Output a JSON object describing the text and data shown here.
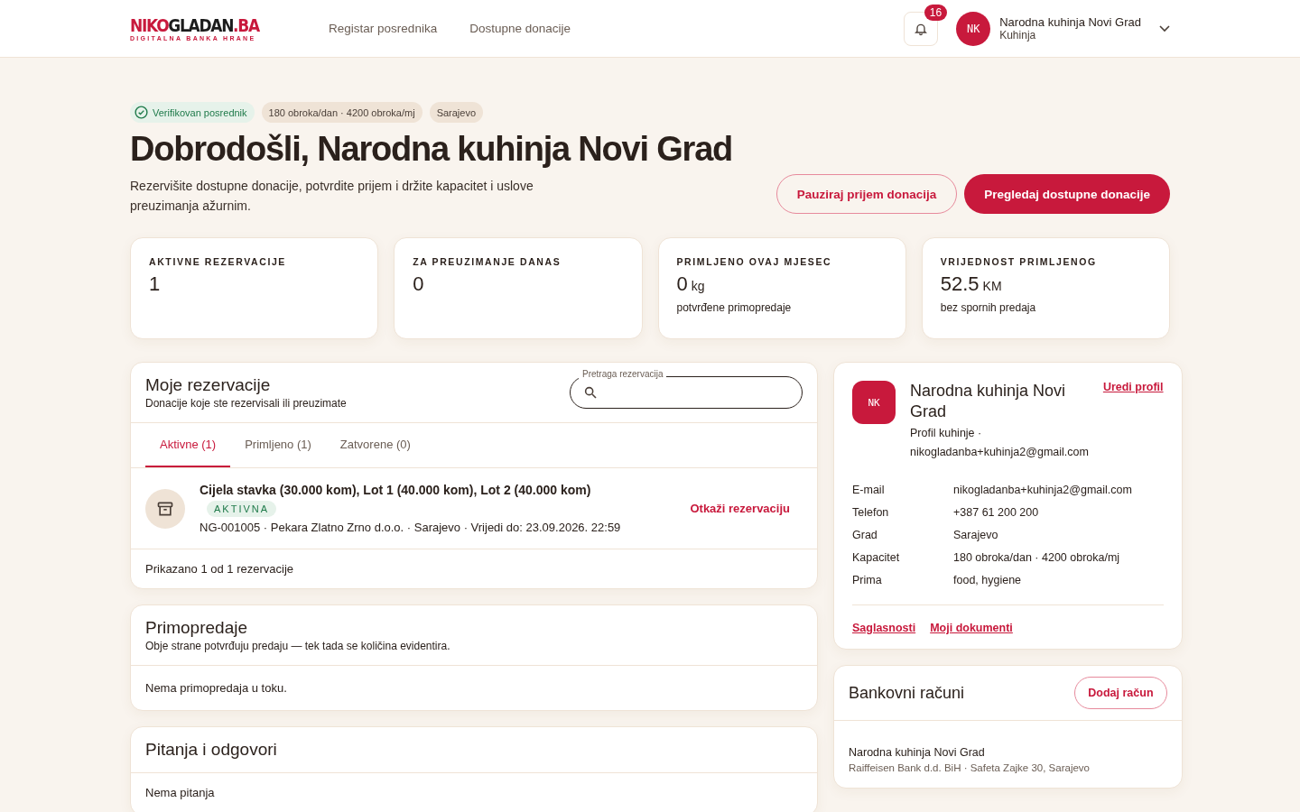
{
  "header": {
    "logo": {
      "accent_start": "NIKO",
      "main": "GLADAN",
      "accent_end": ".BA",
      "tagline": "DIGITALNA BANKA HRANE"
    },
    "nav": [
      "Registar posrednika",
      "Dostupne donacije"
    ],
    "notifications": {
      "count": "16"
    },
    "user": {
      "initials": "NK",
      "name": "Narodna kuhinja Novi Grad",
      "role": "Kuhinja"
    }
  },
  "hero": {
    "badges": [
      {
        "kind": "verified",
        "label": "Verifikovan posrednik"
      },
      {
        "kind": "plain",
        "label": "180 obroka/dan · 4200 obroka/mj"
      },
      {
        "kind": "plain",
        "label": "Sarajevo"
      }
    ],
    "title": "Dobrodošli, Narodna kuhinja Novi Grad",
    "subtitle": "Rezervišite dostupne donacije, potvrdite prijem i držite kapacitet i uslove preuzimanja ažurnim.",
    "buttons": [
      {
        "kind": "outline",
        "label": "Pauziraj prijem donacija"
      },
      {
        "kind": "primary",
        "label": "Pregledaj dostupne donacije"
      }
    ]
  },
  "stats": [
    {
      "label": "AKTIVNE REZERVACIJE",
      "value": "1"
    },
    {
      "label": "ZA PREUZIMANJE DANAS",
      "value": "0"
    },
    {
      "label": "PRIMLJENO OVAJ MJESEC",
      "value": "0",
      "unit": "kg",
      "note": "potvrđene primopredaje"
    },
    {
      "label": "VRIJEDNOST PRIMLJENOG",
      "value": "52.5",
      "unit": "KM",
      "note": "bez spornih predaja"
    }
  ],
  "reservations": {
    "title": "Moje rezervacije",
    "subtitle": "Donacije koje ste rezervisali ili preuzimate",
    "search": {
      "label": "Pretraga rezervacija"
    },
    "tabs": [
      {
        "label": "Aktivne (1)",
        "selected": true
      },
      {
        "label": "Primljeno (1)",
        "selected": false
      },
      {
        "label": "Zatvorene (0)",
        "selected": false
      }
    ],
    "items": [
      {
        "title": "Cijela stavka (30.000 kom), Lot 1 (40.000 kom), Lot 2 (40.000 kom)",
        "status": "AKTIVNA",
        "meta": "NG-001005 · Pekara Zlatno Zrno d.o.o. · Sarajevo · Vrijedi do: 23.09.2026. 22:59",
        "action": "Otkaži rezervaciju"
      }
    ],
    "footer": "Prikazano 1 od 1 rezervacije"
  },
  "handovers": {
    "title": "Primopredaje",
    "subtitle": "Obje strane potvrđuju predaju — tek tada se količina evidentira.",
    "empty": "Nema primopredaja u toku."
  },
  "qa": {
    "title": "Pitanja i odgovori",
    "empty": "Nema pitanja"
  },
  "profile": {
    "initials": "NK",
    "name": "Narodna kuhinja Novi Grad",
    "subtitle": "Profil kuhinje · nikogladanba+kuhinja2@gmail.com",
    "edit": "Uredi profil",
    "fields": [
      {
        "label": "E-mail",
        "value": "nikogladanba+kuhinja2@gmail.com"
      },
      {
        "label": "Telefon",
        "value": "+387 61 200 200"
      },
      {
        "label": "Grad",
        "value": "Sarajevo"
      },
      {
        "label": "Kapacitet",
        "value": "180 obroka/dan · 4200 obroka/mj"
      },
      {
        "label": "Prima",
        "value": "food, hygiene"
      }
    ],
    "links": [
      "Saglasnosti",
      "Moji dokumenti"
    ]
  },
  "bank": {
    "title": "Bankovni računi",
    "add": "Dodaj račun",
    "accounts": [
      {
        "name": "Narodna kuhinja Novi Grad",
        "details": "Raiffeisen Bank d.d. BiH · Safeta Zajke 30, Sarajevo"
      }
    ]
  }
}
